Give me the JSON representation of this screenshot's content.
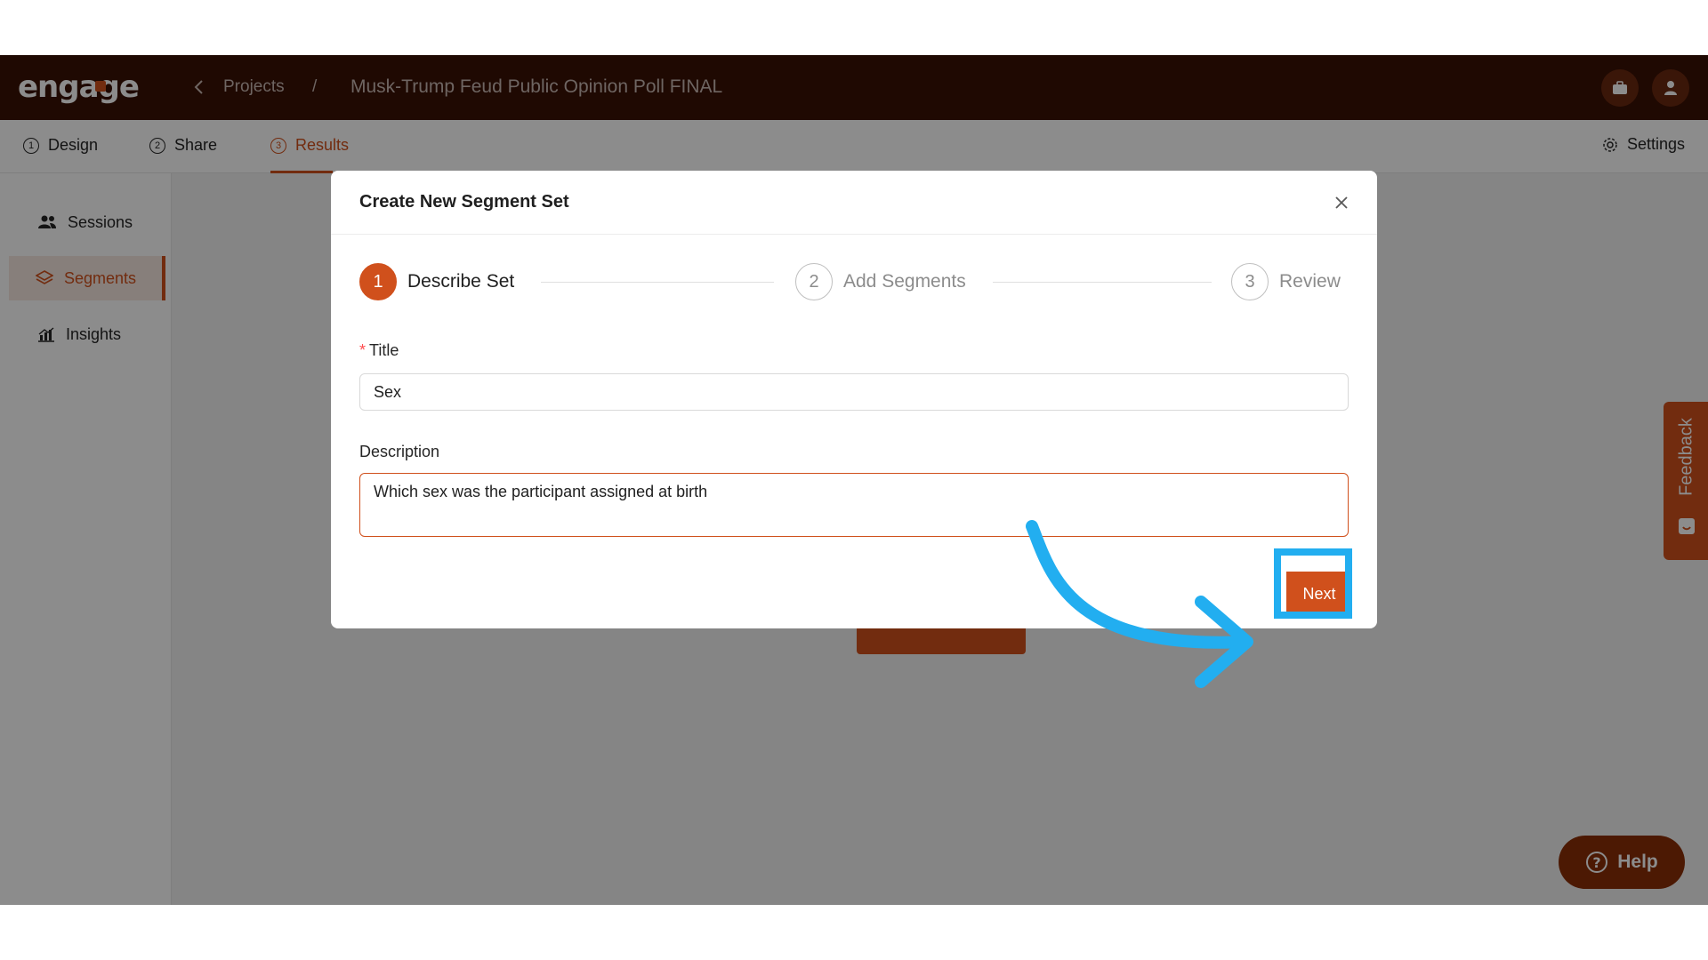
{
  "header": {
    "logo_text": "engage",
    "breadcrumb_projects": "Projects",
    "breadcrumb_separator": "/",
    "project_title": "Musk-Trump Feud Public Opinion Poll FINAL"
  },
  "tabs": [
    {
      "num": "1",
      "label": "Design"
    },
    {
      "num": "2",
      "label": "Share"
    },
    {
      "num": "3",
      "label": "Results",
      "active": true
    }
  ],
  "settings_label": "Settings",
  "sidebar": {
    "items": [
      {
        "label": "Sessions",
        "icon": "users-icon"
      },
      {
        "label": "Segments",
        "icon": "layers-icon",
        "active": true
      },
      {
        "label": "Insights",
        "icon": "chart-icon"
      }
    ]
  },
  "feedback_label": "Feedback",
  "help_label": "Help",
  "modal": {
    "title": "Create New Segment Set",
    "steps": [
      {
        "num": "1",
        "label": "Describe Set",
        "active": true
      },
      {
        "num": "2",
        "label": "Add Segments"
      },
      {
        "num": "3",
        "label": "Review"
      }
    ],
    "title_label": "Title",
    "title_value": "Sex",
    "description_label": "Description",
    "description_value": "Which sex was the participant assigned at birth",
    "next_label": "Next"
  },
  "colors": {
    "brand": "#d0501c",
    "header_bg": "#3a1104",
    "annotation": "#22aef0"
  }
}
